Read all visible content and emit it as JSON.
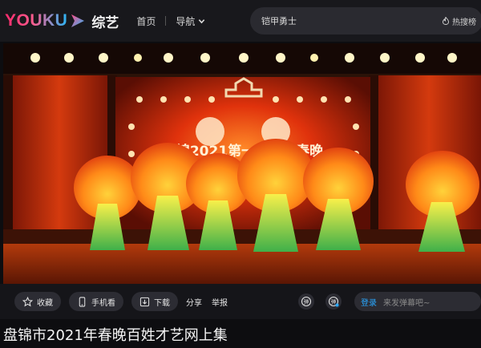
{
  "header": {
    "logo_text": "YOUKU",
    "channel": "综艺",
    "nav": {
      "home": "首页",
      "guide": "导航"
    },
    "search": {
      "query": "铠甲勇士",
      "hot_label": "热搜榜"
    }
  },
  "video": {
    "stage_banner": "盘锦2021第一届百姓春晚"
  },
  "controls": {
    "favorite": "收藏",
    "phone_watch": "手机看",
    "download": "下载",
    "share": "分享",
    "report": "举报",
    "danmu_login": "登录",
    "danmu_placeholder": "来发弹幕吧~"
  },
  "title": "盘锦市2021年春晚百姓才艺网上集",
  "colors": {
    "accent_blue": "#29a8ff",
    "logo_pink": "#ff2a6d",
    "logo_blue": "#29b6f6"
  }
}
